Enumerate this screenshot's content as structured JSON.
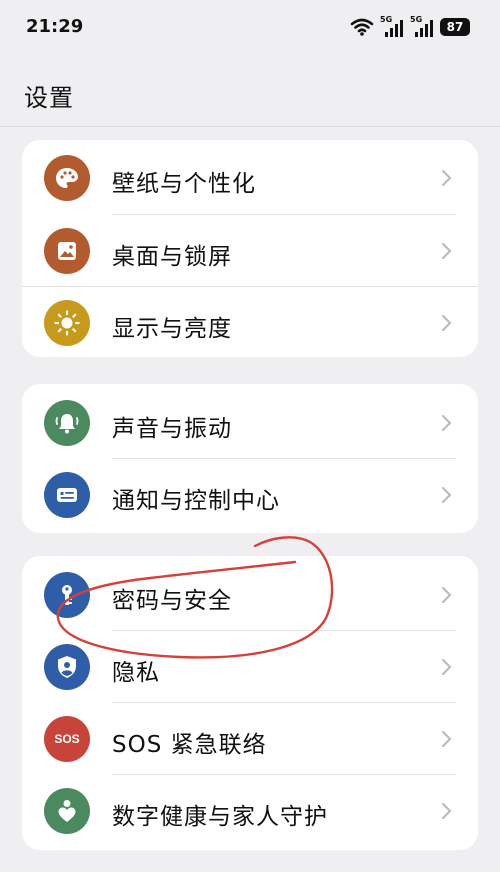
{
  "status": {
    "time": "21:29",
    "signal1_tag": "5G",
    "signal2_tag": "5G",
    "battery": "87"
  },
  "header": {
    "title": "设置"
  },
  "groups": [
    {
      "items": [
        {
          "label": "壁纸与个性化",
          "icon": "palette-icon",
          "color": "#b25b2e"
        },
        {
          "label": "桌面与锁屏",
          "icon": "picture-icon",
          "color": "#b25b2e"
        },
        {
          "label": "显示与亮度",
          "icon": "sun-icon",
          "color": "#c89a1c"
        }
      ]
    },
    {
      "items": [
        {
          "label": "声音与振动",
          "icon": "bell-icon",
          "color": "#4a8a5e"
        },
        {
          "label": "通知与控制中心",
          "icon": "notification-icon",
          "color": "#2f5ea8"
        }
      ]
    },
    {
      "items": [
        {
          "label": "密码与安全",
          "icon": "key-icon",
          "color": "#2f5ea8"
        },
        {
          "label": "隐私",
          "icon": "shield-icon",
          "color": "#2f5ea8"
        },
        {
          "label": "SOS 紧急联络",
          "icon": "sos-icon",
          "icon_text": "SOS",
          "color": "#c8443a"
        },
        {
          "label": "数字健康与家人守护",
          "icon": "person-heart-icon",
          "color": "#4a8a5e"
        }
      ]
    }
  ],
  "annotation_color": "#d64038"
}
